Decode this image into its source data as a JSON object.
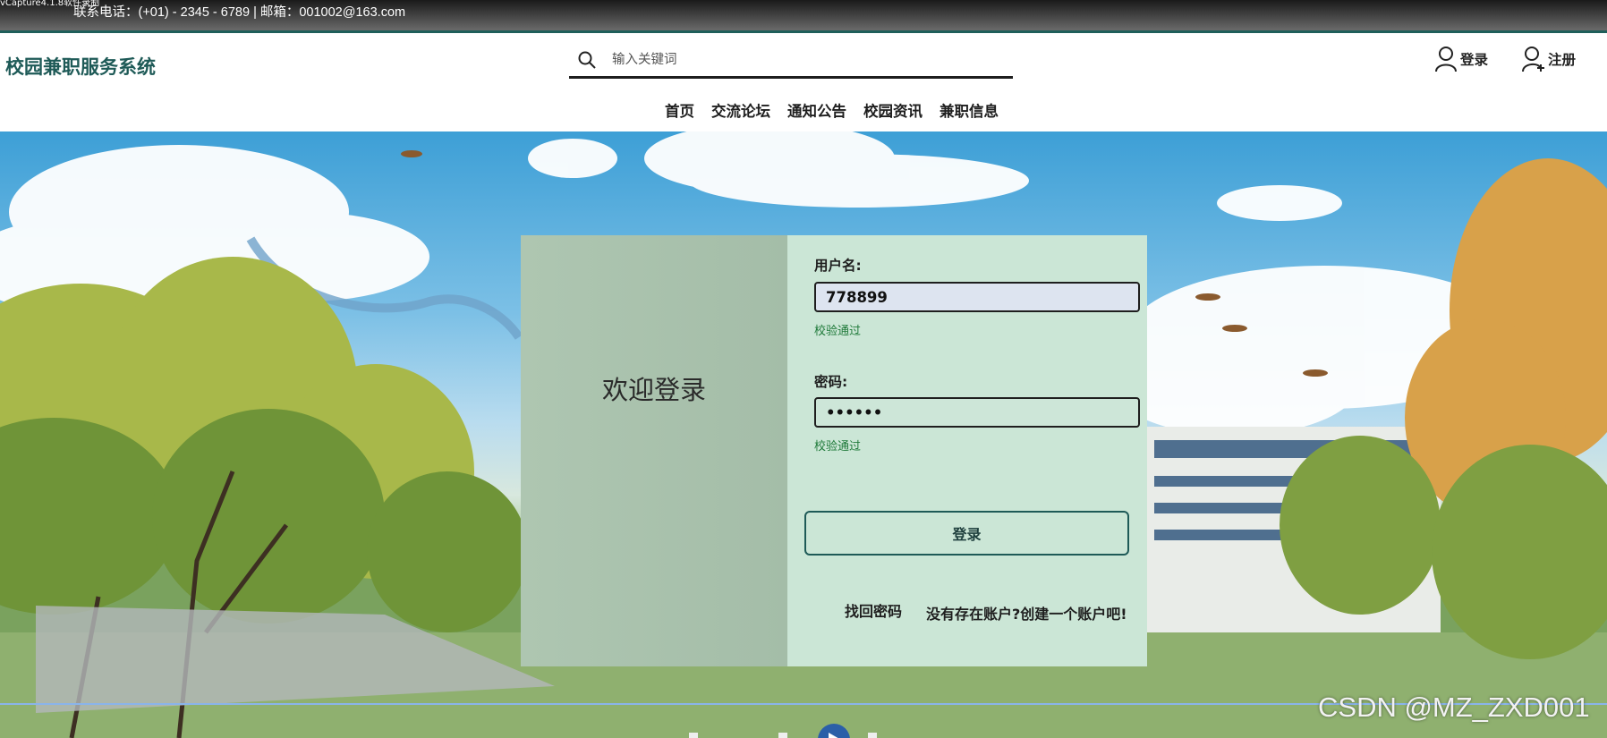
{
  "topbar": {
    "overlay_text": "vCapture4.1.8软件录制",
    "contact": "联系电话：(+01) - 2345 - 6789 | 邮箱：001002@163.com"
  },
  "header": {
    "brand": "校园兼职服务系统",
    "search_placeholder": "输入关键词",
    "login_label": "登录",
    "register_label": "注册"
  },
  "nav": [
    "首页",
    "交流论坛",
    "通知公告",
    "校园资讯",
    "兼职信息"
  ],
  "login": {
    "welcome": "欢迎登录",
    "username_label": "用户名:",
    "username_value": "778899",
    "username_hint": "校验通过",
    "password_label": "密码:",
    "password_value": "••••••",
    "password_hint": "校验通过",
    "submit_label": "登录",
    "forgot_label": "找回密码",
    "signup_label": "没有存在账户?创建一个账户吧!"
  },
  "watermark": "CSDN @MZ_ZXD001",
  "colors": {
    "brand": "#1e5a57",
    "card_left": "#aec6b1",
    "card_right": "#cbe6d6",
    "hint": "#1f7a3a"
  }
}
